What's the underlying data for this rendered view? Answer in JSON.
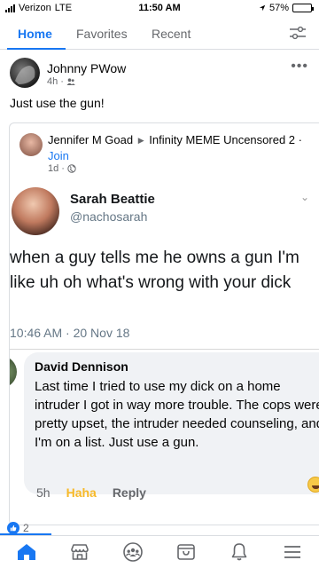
{
  "status_bar": {
    "carrier": "Verizon",
    "network": "LTE",
    "time": "11:50 AM",
    "battery": "57%",
    "battery_level": 0.57
  },
  "top_tabs": [
    {
      "label": "Home",
      "active": true
    },
    {
      "label": "Favorites",
      "active": false
    },
    {
      "label": "Recent",
      "active": false
    }
  ],
  "post": {
    "author": "Johnny PWow",
    "time": "4h",
    "audience_icon": "friends-icon",
    "text": "Just use the gun!"
  },
  "shared_post": {
    "author": "Jennifer M Goad",
    "group": "Infinity MEME Uncensored 2",
    "join_label": "Join",
    "time": "1d",
    "audience_icon": "globe-icon"
  },
  "meme": {
    "tweet": {
      "name": "Sarah Beattie",
      "handle": "@nachosarah",
      "text": "when a guy tells me he owns a gun I'm like uh oh what's wrong with your dick",
      "timestamp": "10:46 AM · 20 Nov 18"
    },
    "comment": {
      "author": "David Dennison",
      "text": "Last time I tried to use my dick on a home intruder I got in way more trouble. The cops were pretty upset, the intruder needed counseling, and I'm on a list. Just use a gun.",
      "time": "5h",
      "reaction": "Haha",
      "reply": "Reply"
    }
  },
  "reactions": {
    "count": "2",
    "type_icon": "like-icon"
  },
  "bottom_nav": [
    "home-icon",
    "marketplace-icon",
    "groups-icon",
    "shop-icon",
    "notifications-icon",
    "menu-icon"
  ],
  "colors": {
    "accent": "#1877f2",
    "secondary_text": "#65676b",
    "haha": "#f7b928"
  }
}
